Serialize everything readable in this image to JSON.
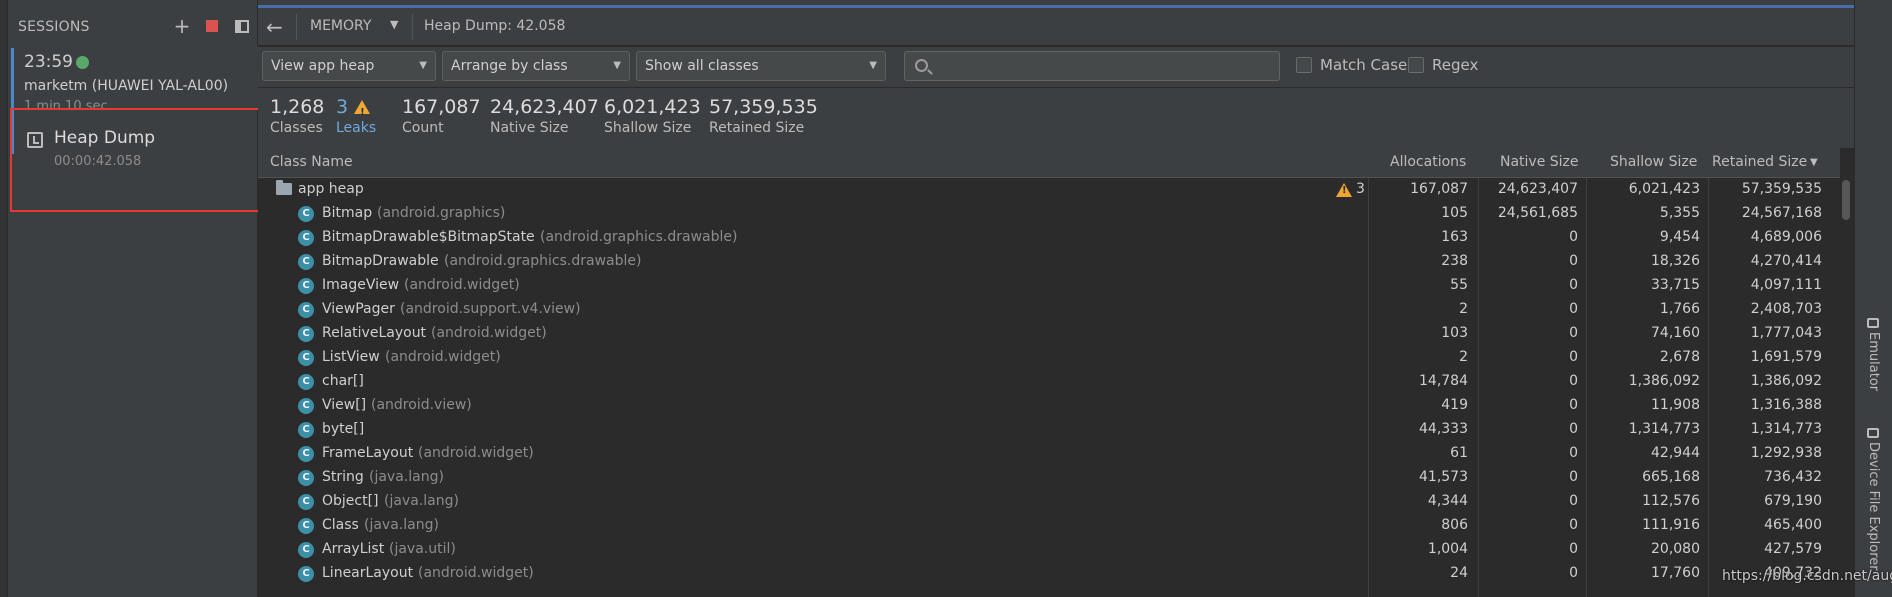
{
  "sessions": {
    "title": "SESSIONS",
    "add_icon": "plus-icon",
    "stop_icon": "stop-icon",
    "layout_icon": "panel-icon",
    "session": {
      "time": "23:59",
      "status_color": "#59a869",
      "device": "marketm (HUAWEI YAL-AL00)",
      "duration": "1 min 10 sec"
    },
    "heap_dump": {
      "title": "Heap Dump",
      "timestamp": "00:00:42.058"
    }
  },
  "toolbar": {
    "profiler": "MEMORY",
    "dump_title": "Heap Dump: 42.058"
  },
  "filters": {
    "heap": "View app heap",
    "arrange": "Arrange by class",
    "show": "Show all classes",
    "search_placeholder": "",
    "match_case": "Match Case",
    "regex": "Regex"
  },
  "stats": {
    "classes": {
      "value": "1,268",
      "label": "Classes"
    },
    "leaks": {
      "value": "3",
      "label": "Leaks"
    },
    "count": {
      "value": "167,087",
      "label": "Count"
    },
    "native": {
      "value": "24,623,407",
      "label": "Native Size"
    },
    "shallow": {
      "value": "6,021,423",
      "label": "Shallow Size"
    },
    "retained": {
      "value": "57,359,535",
      "label": "Retained Size"
    }
  },
  "columns": {
    "class_name": "Class Name",
    "allocations": "Allocations",
    "native": "Native Size",
    "shallow": "Shallow Size",
    "retained": "Retained Size"
  },
  "root": {
    "name": "app heap",
    "leaks": "3",
    "allocations": "167,087",
    "native": "24,623,407",
    "shallow": "6,021,423",
    "retained": "57,359,535"
  },
  "rows": [
    {
      "name": "Bitmap",
      "pkg": "(android.graphics)",
      "allocations": "105",
      "native": "24,561,685",
      "shallow": "5,355",
      "retained": "24,567,168"
    },
    {
      "name": "BitmapDrawable$BitmapState",
      "pkg": "(android.graphics.drawable)",
      "allocations": "163",
      "native": "0",
      "shallow": "9,454",
      "retained": "4,689,006"
    },
    {
      "name": "BitmapDrawable",
      "pkg": "(android.graphics.drawable)",
      "allocations": "238",
      "native": "0",
      "shallow": "18,326",
      "retained": "4,270,414"
    },
    {
      "name": "ImageView",
      "pkg": "(android.widget)",
      "allocations": "55",
      "native": "0",
      "shallow": "33,715",
      "retained": "4,097,111"
    },
    {
      "name": "ViewPager",
      "pkg": "(android.support.v4.view)",
      "allocations": "2",
      "native": "0",
      "shallow": "1,766",
      "retained": "2,408,703"
    },
    {
      "name": "RelativeLayout",
      "pkg": "(android.widget)",
      "allocations": "103",
      "native": "0",
      "shallow": "74,160",
      "retained": "1,777,043"
    },
    {
      "name": "ListView",
      "pkg": "(android.widget)",
      "allocations": "2",
      "native": "0",
      "shallow": "2,678",
      "retained": "1,691,579"
    },
    {
      "name": "char[]",
      "pkg": "",
      "allocations": "14,784",
      "native": "0",
      "shallow": "1,386,092",
      "retained": "1,386,092"
    },
    {
      "name": "View[]",
      "pkg": "(android.view)",
      "allocations": "419",
      "native": "0",
      "shallow": "11,908",
      "retained": "1,316,388"
    },
    {
      "name": "byte[]",
      "pkg": "",
      "allocations": "44,333",
      "native": "0",
      "shallow": "1,314,773",
      "retained": "1,314,773"
    },
    {
      "name": "FrameLayout",
      "pkg": "(android.widget)",
      "allocations": "61",
      "native": "0",
      "shallow": "42,944",
      "retained": "1,292,938"
    },
    {
      "name": "String",
      "pkg": "(java.lang)",
      "allocations": "41,573",
      "native": "0",
      "shallow": "665,168",
      "retained": "736,432"
    },
    {
      "name": "Object[]",
      "pkg": "(java.lang)",
      "allocations": "4,344",
      "native": "0",
      "shallow": "112,576",
      "retained": "679,190"
    },
    {
      "name": "Class",
      "pkg": "(java.lang)",
      "allocations": "806",
      "native": "0",
      "shallow": "111,916",
      "retained": "465,400"
    },
    {
      "name": "ArrayList",
      "pkg": "(java.util)",
      "allocations": "1,004",
      "native": "0",
      "shallow": "20,080",
      "retained": "427,579"
    },
    {
      "name": "LinearLayout",
      "pkg": "(android.widget)",
      "allocations": "24",
      "native": "0",
      "shallow": "17,760",
      "retained": "409,732"
    }
  ],
  "right_tabs": {
    "emulator": "Emulator",
    "device_file_explorer": "Device File Explorer"
  },
  "watermark": "https://blog.csdn.net/augfun",
  "colors": {
    "accent": "#4a88c7",
    "highlight_box": "#e53935",
    "class_icon": "#3d8fa8",
    "warning": "#f0a732"
  }
}
